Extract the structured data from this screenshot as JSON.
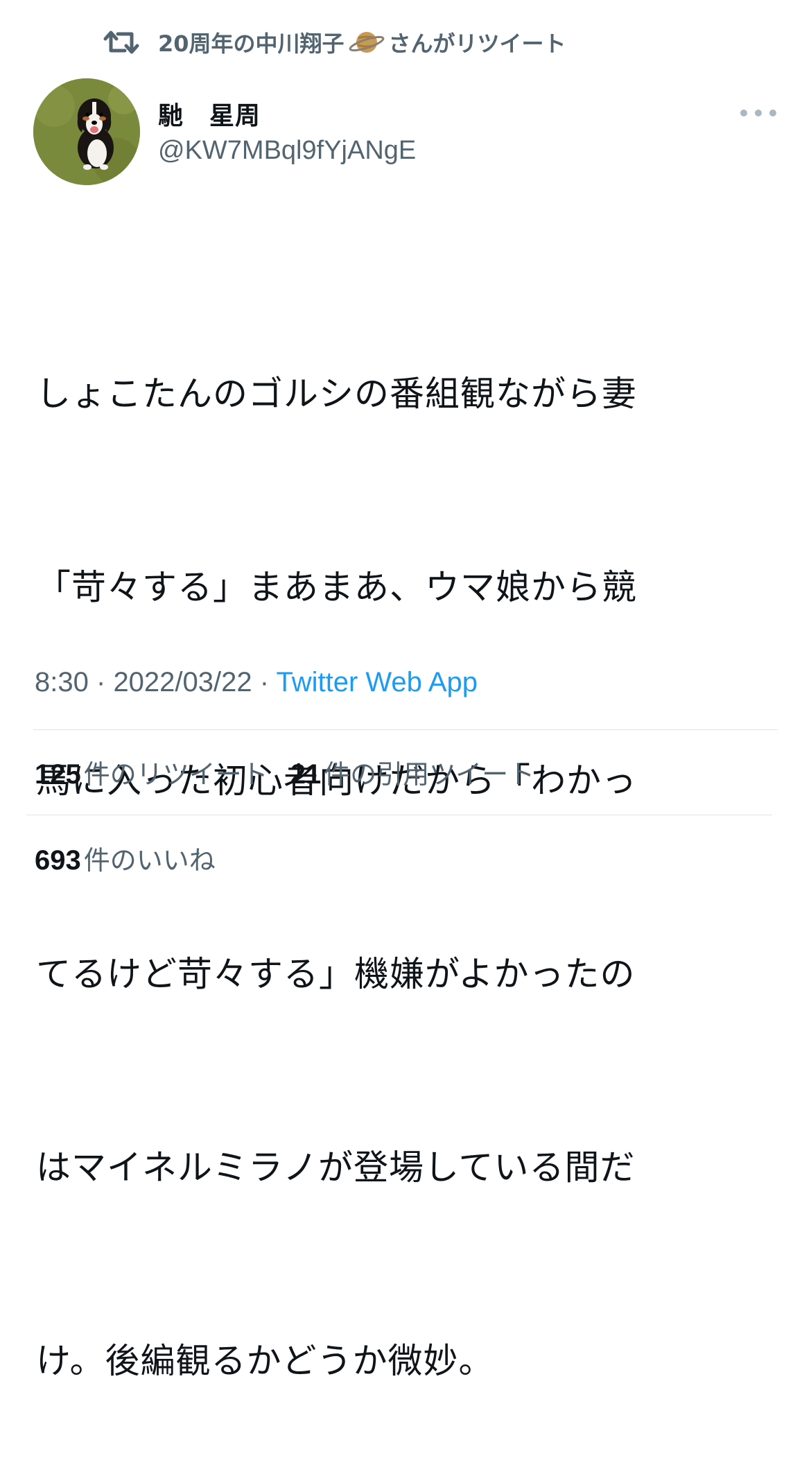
{
  "retweet_header": {
    "icon": "retweet-icon",
    "retweeter_name": "20周年の中川翔子",
    "emoji": "ringed-planet-emoji",
    "suffix": "さんがリツイート"
  },
  "author": {
    "avatar": "dog-avatar",
    "name": "馳　星周",
    "handle": "@KW7MBql9fYjANgE"
  },
  "more_icon": "more-icon",
  "tweet": {
    "lines": [
      "しょこたんのゴルシの番組観ながら妻",
      "「苛々する」まあまあ、ウマ娘から競",
      "馬に入った初心者向けだから「わかっ",
      "てるけど苛々する」機嫌がよかったの",
      "はマイネルミラノが登場している間だ",
      "け。後編観るかどうか微妙。"
    ]
  },
  "meta": {
    "time": "8:30",
    "separator": "·",
    "date": "2022/03/22",
    "source": "Twitter Web App"
  },
  "stats": {
    "retweets_count": "125",
    "retweets_label": "件のリツイート",
    "quotes_count": "21",
    "quotes_label": "件の引用ツイート",
    "likes_count": "693",
    "likes_label": "件のいいね"
  },
  "colors": {
    "text": "#0f1419",
    "secondary": "#536471",
    "link": "#1d9bf0",
    "divider": "#dfe3e6"
  }
}
